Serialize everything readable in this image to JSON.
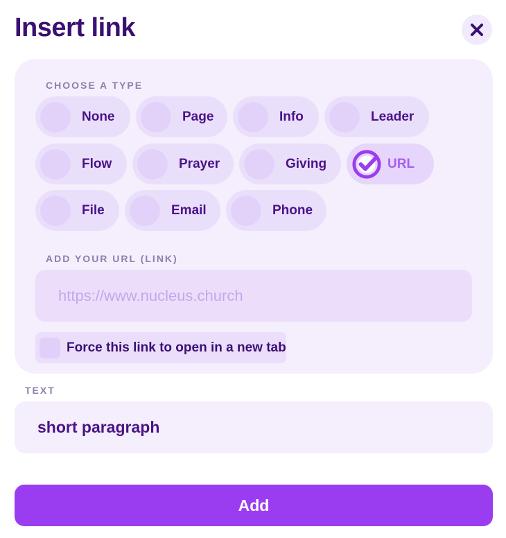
{
  "dialog": {
    "title": "Insert link",
    "close_icon": "close-icon"
  },
  "type_section": {
    "label": "CHOOSE A TYPE",
    "rows": [
      [
        {
          "label": "None",
          "selected": false
        },
        {
          "label": "Page",
          "selected": false
        },
        {
          "label": "Info",
          "selected": false
        },
        {
          "label": "Leader",
          "selected": false
        }
      ],
      [
        {
          "label": "Flow",
          "selected": false
        },
        {
          "label": "Prayer",
          "selected": false
        },
        {
          "label": "Giving",
          "selected": false
        },
        {
          "label": "URL",
          "selected": true,
          "icon": "check-circle-icon"
        }
      ],
      [
        {
          "label": "File",
          "selected": false
        },
        {
          "label": "Email",
          "selected": false
        },
        {
          "label": "Phone",
          "selected": false
        }
      ]
    ]
  },
  "url_section": {
    "label": "ADD YOUR URL (LINK)",
    "value": "",
    "placeholder": "https://www.nucleus.church",
    "force_new_tab_label": "Force this link to open in a new tab",
    "force_new_tab_checked": false
  },
  "text_section": {
    "label": "TEXT",
    "value": "short paragraph"
  },
  "actions": {
    "add_label": "Add"
  },
  "colors": {
    "title": "#3b0f73",
    "accent": "#9a3df0",
    "selected_label": "#a85ef0",
    "panel_bg": "#f5effd"
  }
}
